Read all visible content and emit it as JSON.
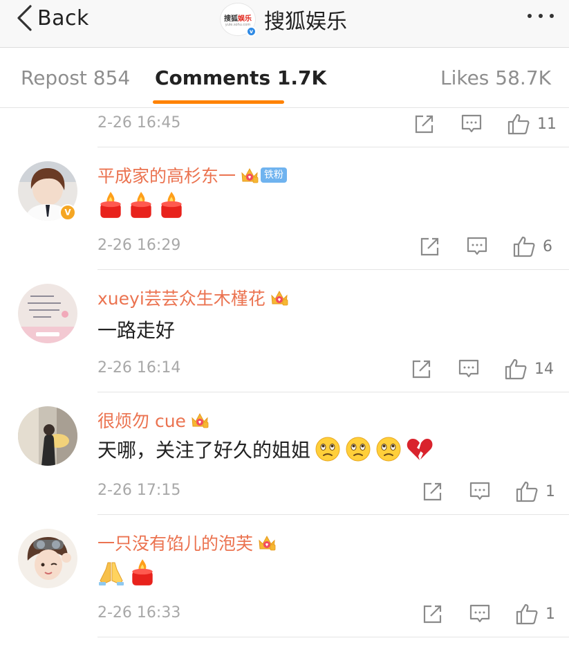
{
  "nav": {
    "back_label": "Back",
    "title": "搜狐娱乐",
    "logo_text_dark": "搜狐",
    "logo_text_red": "娱乐",
    "logo_sub": "yule.sohu.com"
  },
  "tabs": {
    "repost": "Repost 854",
    "comments": "Comments 1.7K",
    "likes": "Likes 58.7K"
  },
  "colors": {
    "accent": "#ff8200",
    "username": "#eb7350",
    "fan_badge": "#6fb3ef"
  },
  "comments": [
    {
      "time": "2-26 16:45",
      "likes": "11"
    },
    {
      "user": "平成家的高杉东一",
      "badge": "铁粉",
      "text": "",
      "emojis": [
        "candle-icon",
        "candle-icon",
        "candle-icon"
      ],
      "time": "2-26 16:29",
      "likes": "6"
    },
    {
      "user": "xueyi芸芸众生木槿花",
      "text": "一路走好",
      "time": "2-26 16:14",
      "likes": "14"
    },
    {
      "user": "很烦勿 cue",
      "text": "天哪，关注了好久的姐姐",
      "emojis": [
        "sad-face-icon",
        "sad-face-icon",
        "sad-face-icon",
        "broken-heart-icon"
      ],
      "time": "2-26 17:15",
      "likes": "1"
    },
    {
      "user": "一只没有馅儿的泡芙",
      "text": "",
      "emojis": [
        "praying-hands-icon",
        "candle-icon"
      ],
      "time": "2-26 16:33",
      "likes": "1"
    }
  ]
}
